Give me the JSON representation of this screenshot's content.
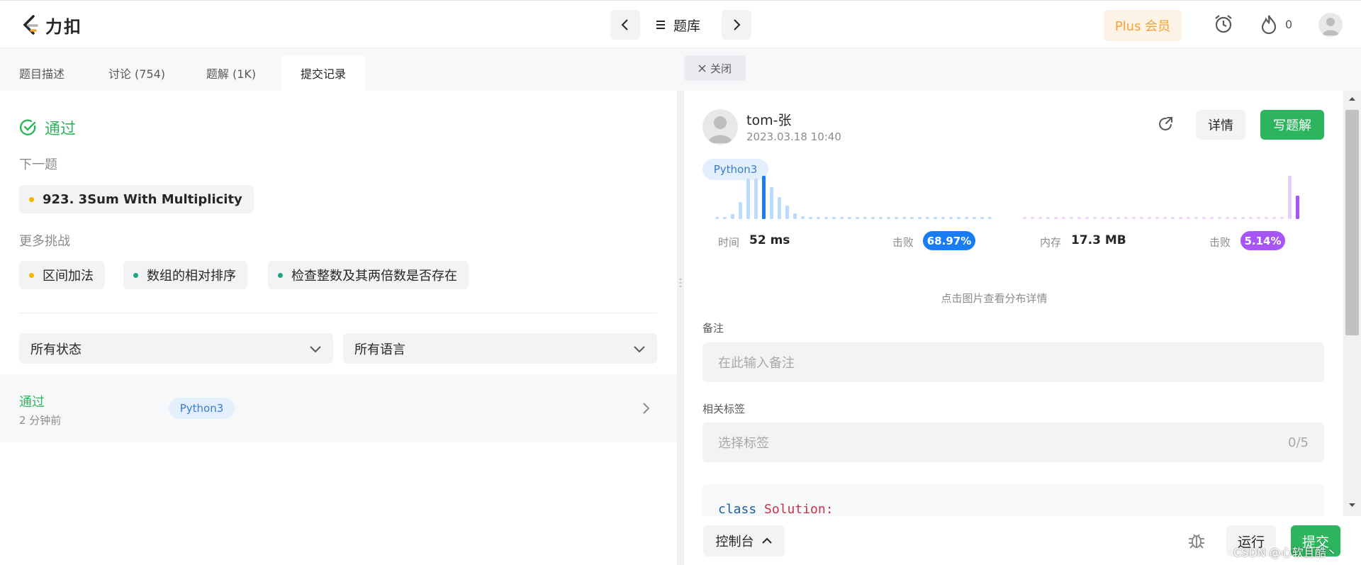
{
  "header": {
    "logo_text": "力扣",
    "problem_bank": "题库",
    "plus_label": "Plus 会员",
    "streak_count": "0"
  },
  "left": {
    "tabs": [
      {
        "label": "题目描述"
      },
      {
        "label": "讨论 (754)"
      },
      {
        "label": "题解 (1K)"
      },
      {
        "label": "提交记录"
      }
    ],
    "result": "通过",
    "next_label": "下一题",
    "next_problem": "923. 3Sum With Multiplicity",
    "more_label": "更多挑战",
    "challenges": [
      {
        "label": "区间加法",
        "color": "#f7b500"
      },
      {
        "label": "数组的相对排序",
        "color": "#1ba784"
      },
      {
        "label": "检查整数及其两倍数是否存在",
        "color": "#1ba784"
      }
    ],
    "filter_status": "所有状态",
    "filter_language": "所有语言",
    "submission": {
      "status": "通过",
      "time": "2 分钟前",
      "language": "Python3"
    }
  },
  "right": {
    "close_label": "关闭",
    "user_name": "tom-张",
    "date": "2023.03.18 10:40",
    "detail_label": "详情",
    "write_label": "写题解",
    "language": "Python3",
    "time_label": "时间",
    "time_value": "52 ms",
    "time_beat_label": "击败",
    "time_beat": "68.97%",
    "mem_label": "内存",
    "mem_value": "17.3 MB",
    "mem_beat_label": "击败",
    "mem_beat": "5.14%",
    "chart_hint": "点击图片查看分布详情",
    "note_label": "备注",
    "note_placeholder": "在此输入备注",
    "tag_label": "相关标签",
    "tag_placeholder": "选择标签",
    "tag_count": "0/5",
    "code_keyword": "class",
    "code_name": "Solution:"
  },
  "bottom": {
    "console_label": "控制台",
    "run_label": "运行",
    "submit_label": "提交",
    "watermark": "CSDN @心软且酷丶"
  },
  "colors": {
    "accent_green": "#2db55d",
    "runtime_blue": "#1a7cf2",
    "memory_purple": "#a855f7"
  }
}
